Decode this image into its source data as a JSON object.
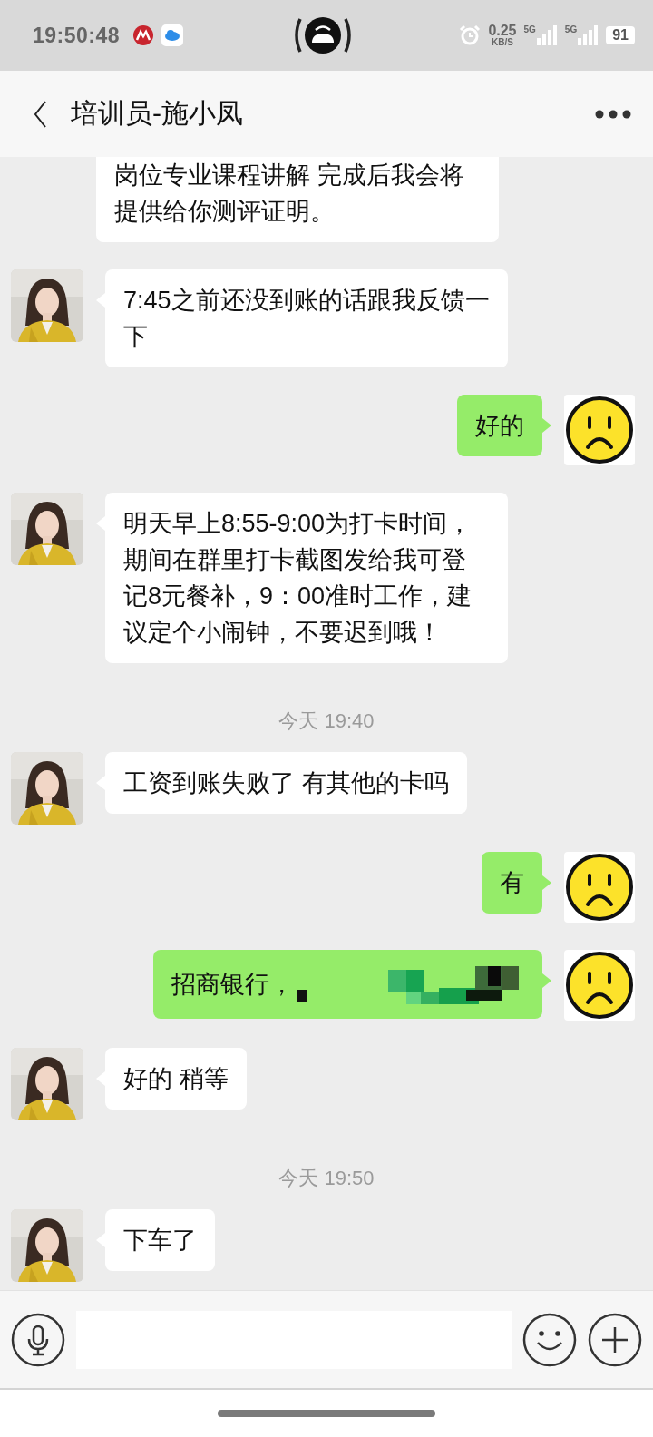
{
  "status_bar": {
    "time": "19:50:48",
    "data_rate": "0.25",
    "data_unit": "KB/S",
    "signals": [
      "5G",
      "5G"
    ],
    "battery": "91"
  },
  "header": {
    "title": "培训员-施小凤"
  },
  "messages": [
    {
      "kind": "incoming",
      "text": "岗位专业课程讲解 完成后我会将提供给你测评证明。",
      "masked": false,
      "cut_top": true
    },
    {
      "kind": "incoming",
      "text": "7:45之前还没到账的话跟我反馈一下",
      "masked": false,
      "cut_top": false
    },
    {
      "kind": "outgoing",
      "text": "好的",
      "masked": false,
      "cut_top": false
    },
    {
      "kind": "incoming",
      "text": "明天早上8:55-9:00为打卡时间，期间在群里打卡截图发给我可登记8元餐补，9：00准时工作，建议定个小闹钟，不要迟到哦！",
      "masked": false,
      "cut_top": false
    },
    {
      "kind": "timestamp",
      "text": "今天 19:40"
    },
    {
      "kind": "incoming",
      "text": "工资到账失败了 有其他的卡吗",
      "masked": false,
      "cut_top": false
    },
    {
      "kind": "outgoing",
      "text": "有",
      "masked": false,
      "cut_top": false
    },
    {
      "kind": "outgoing",
      "text": "招商银行，",
      "masked": true,
      "cut_top": false
    },
    {
      "kind": "incoming",
      "text": "好的 稍等",
      "masked": false,
      "cut_top": false
    },
    {
      "kind": "timestamp",
      "text": "今天 19:50"
    },
    {
      "kind": "incoming",
      "text": "下车了",
      "masked": false,
      "cut_top": false
    }
  ]
}
